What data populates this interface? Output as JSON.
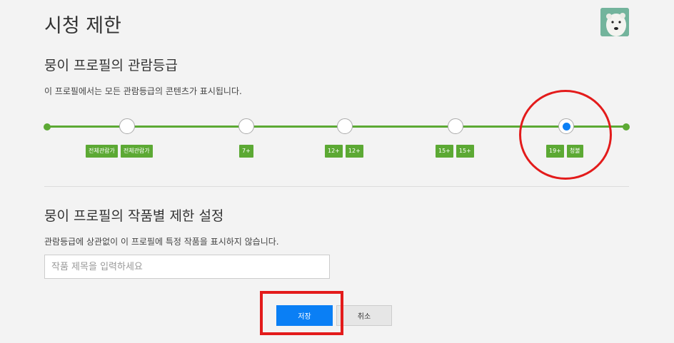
{
  "page": {
    "title": "시청 제한"
  },
  "rating_section": {
    "title": "뭉이 프로필의 관람등급",
    "description": "이 프로필에서는 모든 관람등급의 콘텐츠가 표시됩니다.",
    "levels": [
      {
        "badges": [
          "전체관람가",
          "전체관람가"
        ],
        "selected": false
      },
      {
        "badges": [
          "7+"
        ],
        "selected": false
      },
      {
        "badges": [
          "12+",
          "12+"
        ],
        "selected": false
      },
      {
        "badges": [
          "15+",
          "15+"
        ],
        "selected": false
      },
      {
        "badges": [
          "19+",
          "청불"
        ],
        "selected": true
      }
    ]
  },
  "restriction_section": {
    "title": "뭉이 프로필의 작품별 제한 설정",
    "description": "관람등급에 상관없이 이 프로필에 특정 작품을 표시하지 않습니다.",
    "input_placeholder": "작품 제목을 입력하세요",
    "input_value": ""
  },
  "buttons": {
    "save": "저장",
    "cancel": "취소"
  },
  "colors": {
    "track": "#5ca934",
    "primary": "#0a7ff5",
    "annotation": "#e31b1b"
  },
  "icons": {
    "avatar": "polar-bear-avatar"
  }
}
